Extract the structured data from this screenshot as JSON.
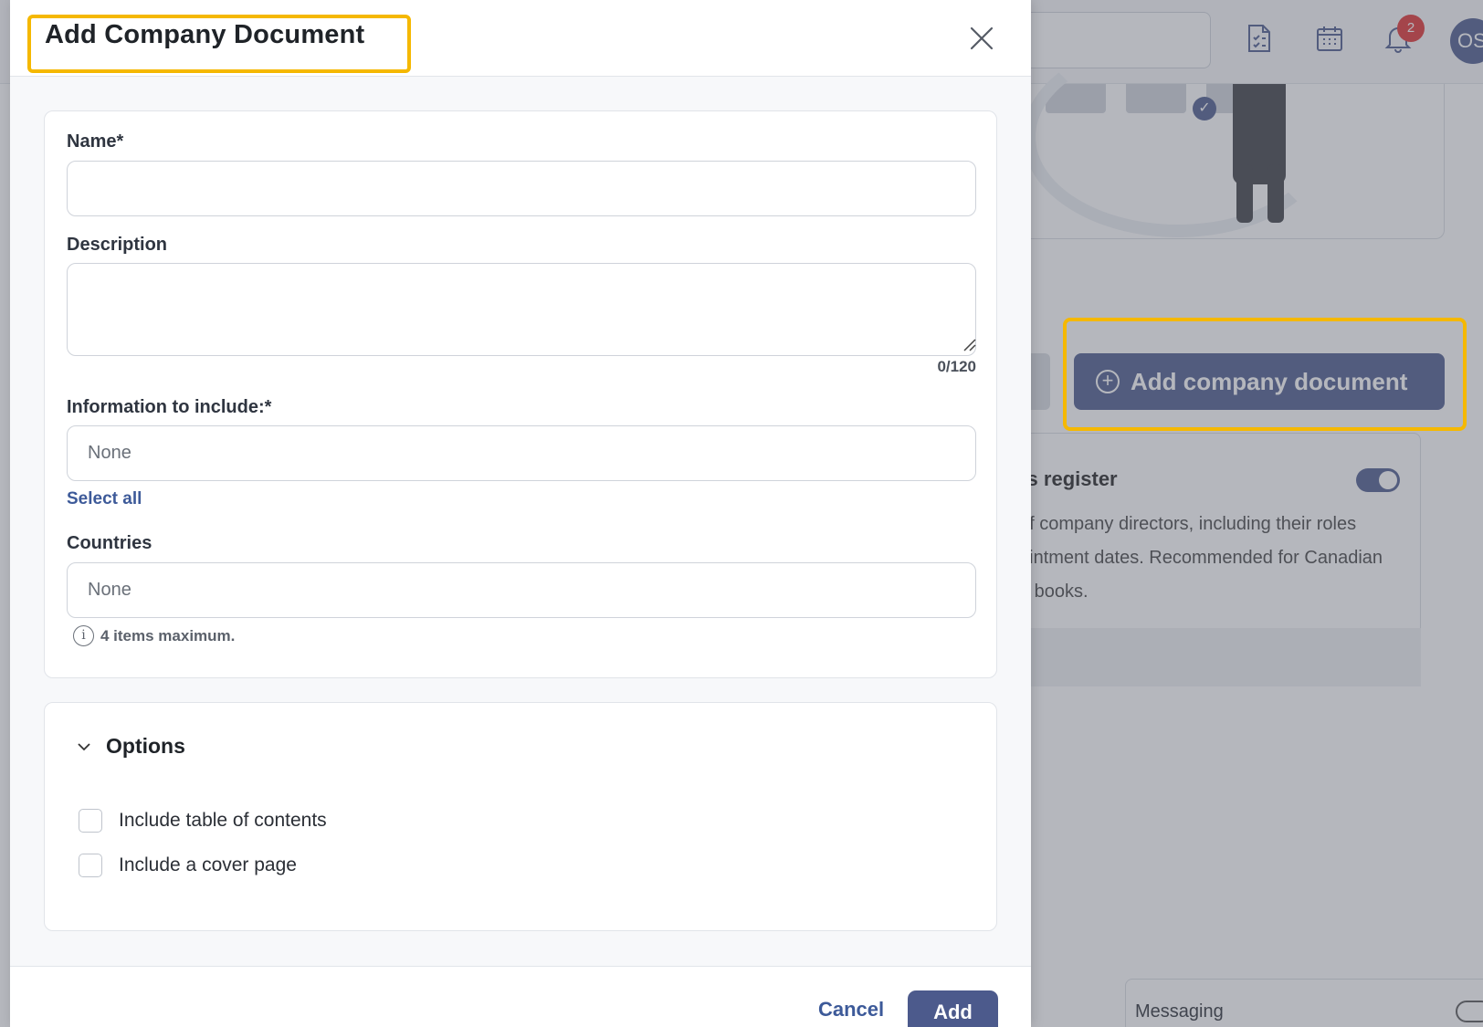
{
  "modal": {
    "title": "Add Company Document",
    "fields": {
      "name_label": "Name*",
      "name_value": "",
      "description_label": "Description",
      "description_value": "",
      "description_counter": "0/120",
      "information_label": "Information to include:*",
      "information_placeholder": "None",
      "select_all": "Select all",
      "countries_label": "Countries",
      "countries_placeholder": "None",
      "countries_hint": "4 items maximum."
    },
    "options": {
      "title": "Options",
      "checkboxes": [
        {
          "label": "Include table of contents",
          "checked": false
        },
        {
          "label": "Include a cover page",
          "checked": false
        }
      ]
    },
    "footer": {
      "cancel_label": "Cancel",
      "add_label": "Add"
    }
  },
  "background": {
    "notification_count": "2",
    "avatar_initials": "OS",
    "add_button_label": "Add company document",
    "card_title": "rs register",
    "card_description": "of company directors, including their roles\nointment dates. Recommended for Canadian\ne books.",
    "messaging_label": "Messaging",
    "accent_color": "#4c5a8c",
    "highlight_color": "#f5b800"
  }
}
